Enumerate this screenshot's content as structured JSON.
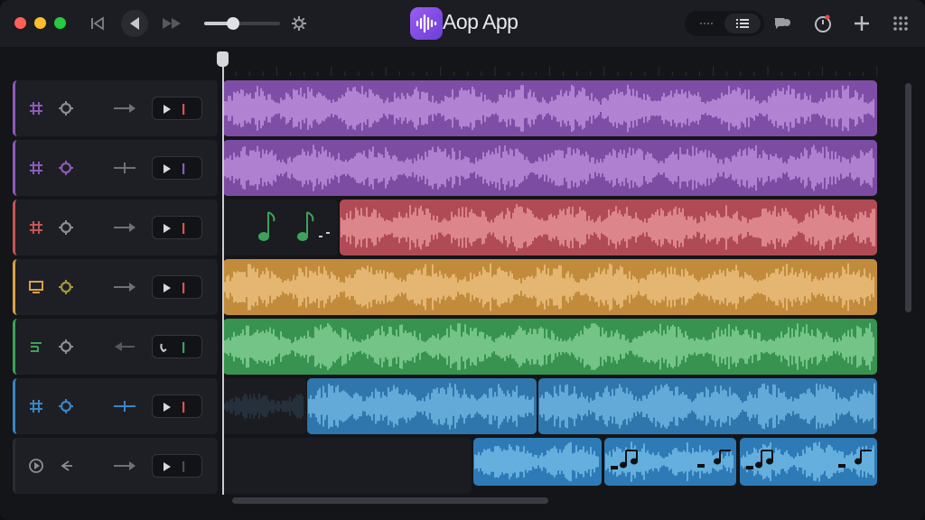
{
  "app": {
    "title": "Aop App"
  },
  "window_controls": {
    "close_color": "#ff5f57",
    "minimize_color": "#febc2e",
    "zoom_color": "#28c840"
  },
  "toolbar": {
    "left_icons": [
      "skip-back-icon",
      "play-reverse-icon",
      "fast-forward-icon"
    ],
    "volume": {
      "level": 0.38
    },
    "settings_icon": "gear-icon",
    "right_icons": [
      "dots-view-icon",
      "list-view-icon",
      "speech-bubble-icon",
      "timer-icon",
      "plus-icon",
      "grid-menu-icon"
    ]
  },
  "accent": "#8b52e8",
  "tracks": [
    {
      "id": 1,
      "color": "#8d5ab8",
      "clip_color": "#7e4ea6",
      "wave_color": "#c79ae6"
    },
    {
      "id": 2,
      "color": "#8d5ab8",
      "clip_color": "#7c4ca3",
      "wave_color": "#c597e4"
    },
    {
      "id": 3,
      "color": "#c45555",
      "clip_color": "#b04b56",
      "wave_color": "#f0a0a4"
    },
    {
      "id": 4,
      "color": "#d8a14a",
      "clip_color": "#c28b3c",
      "wave_color": "#f2c88a"
    },
    {
      "id": 5,
      "color": "#3ea25a",
      "clip_color": "#37934f",
      "wave_color": "#8fd9a0"
    },
    {
      "id": 6,
      "color": "#3a86c4",
      "clip_color": "#2f76ad",
      "wave_color": "#7cc1ea"
    },
    {
      "id": 7,
      "color": "#2a2c33",
      "clip_color": "#2e7ab6",
      "wave_color": "#7cc6ee"
    }
  ],
  "playhead": {
    "position": 0
  }
}
